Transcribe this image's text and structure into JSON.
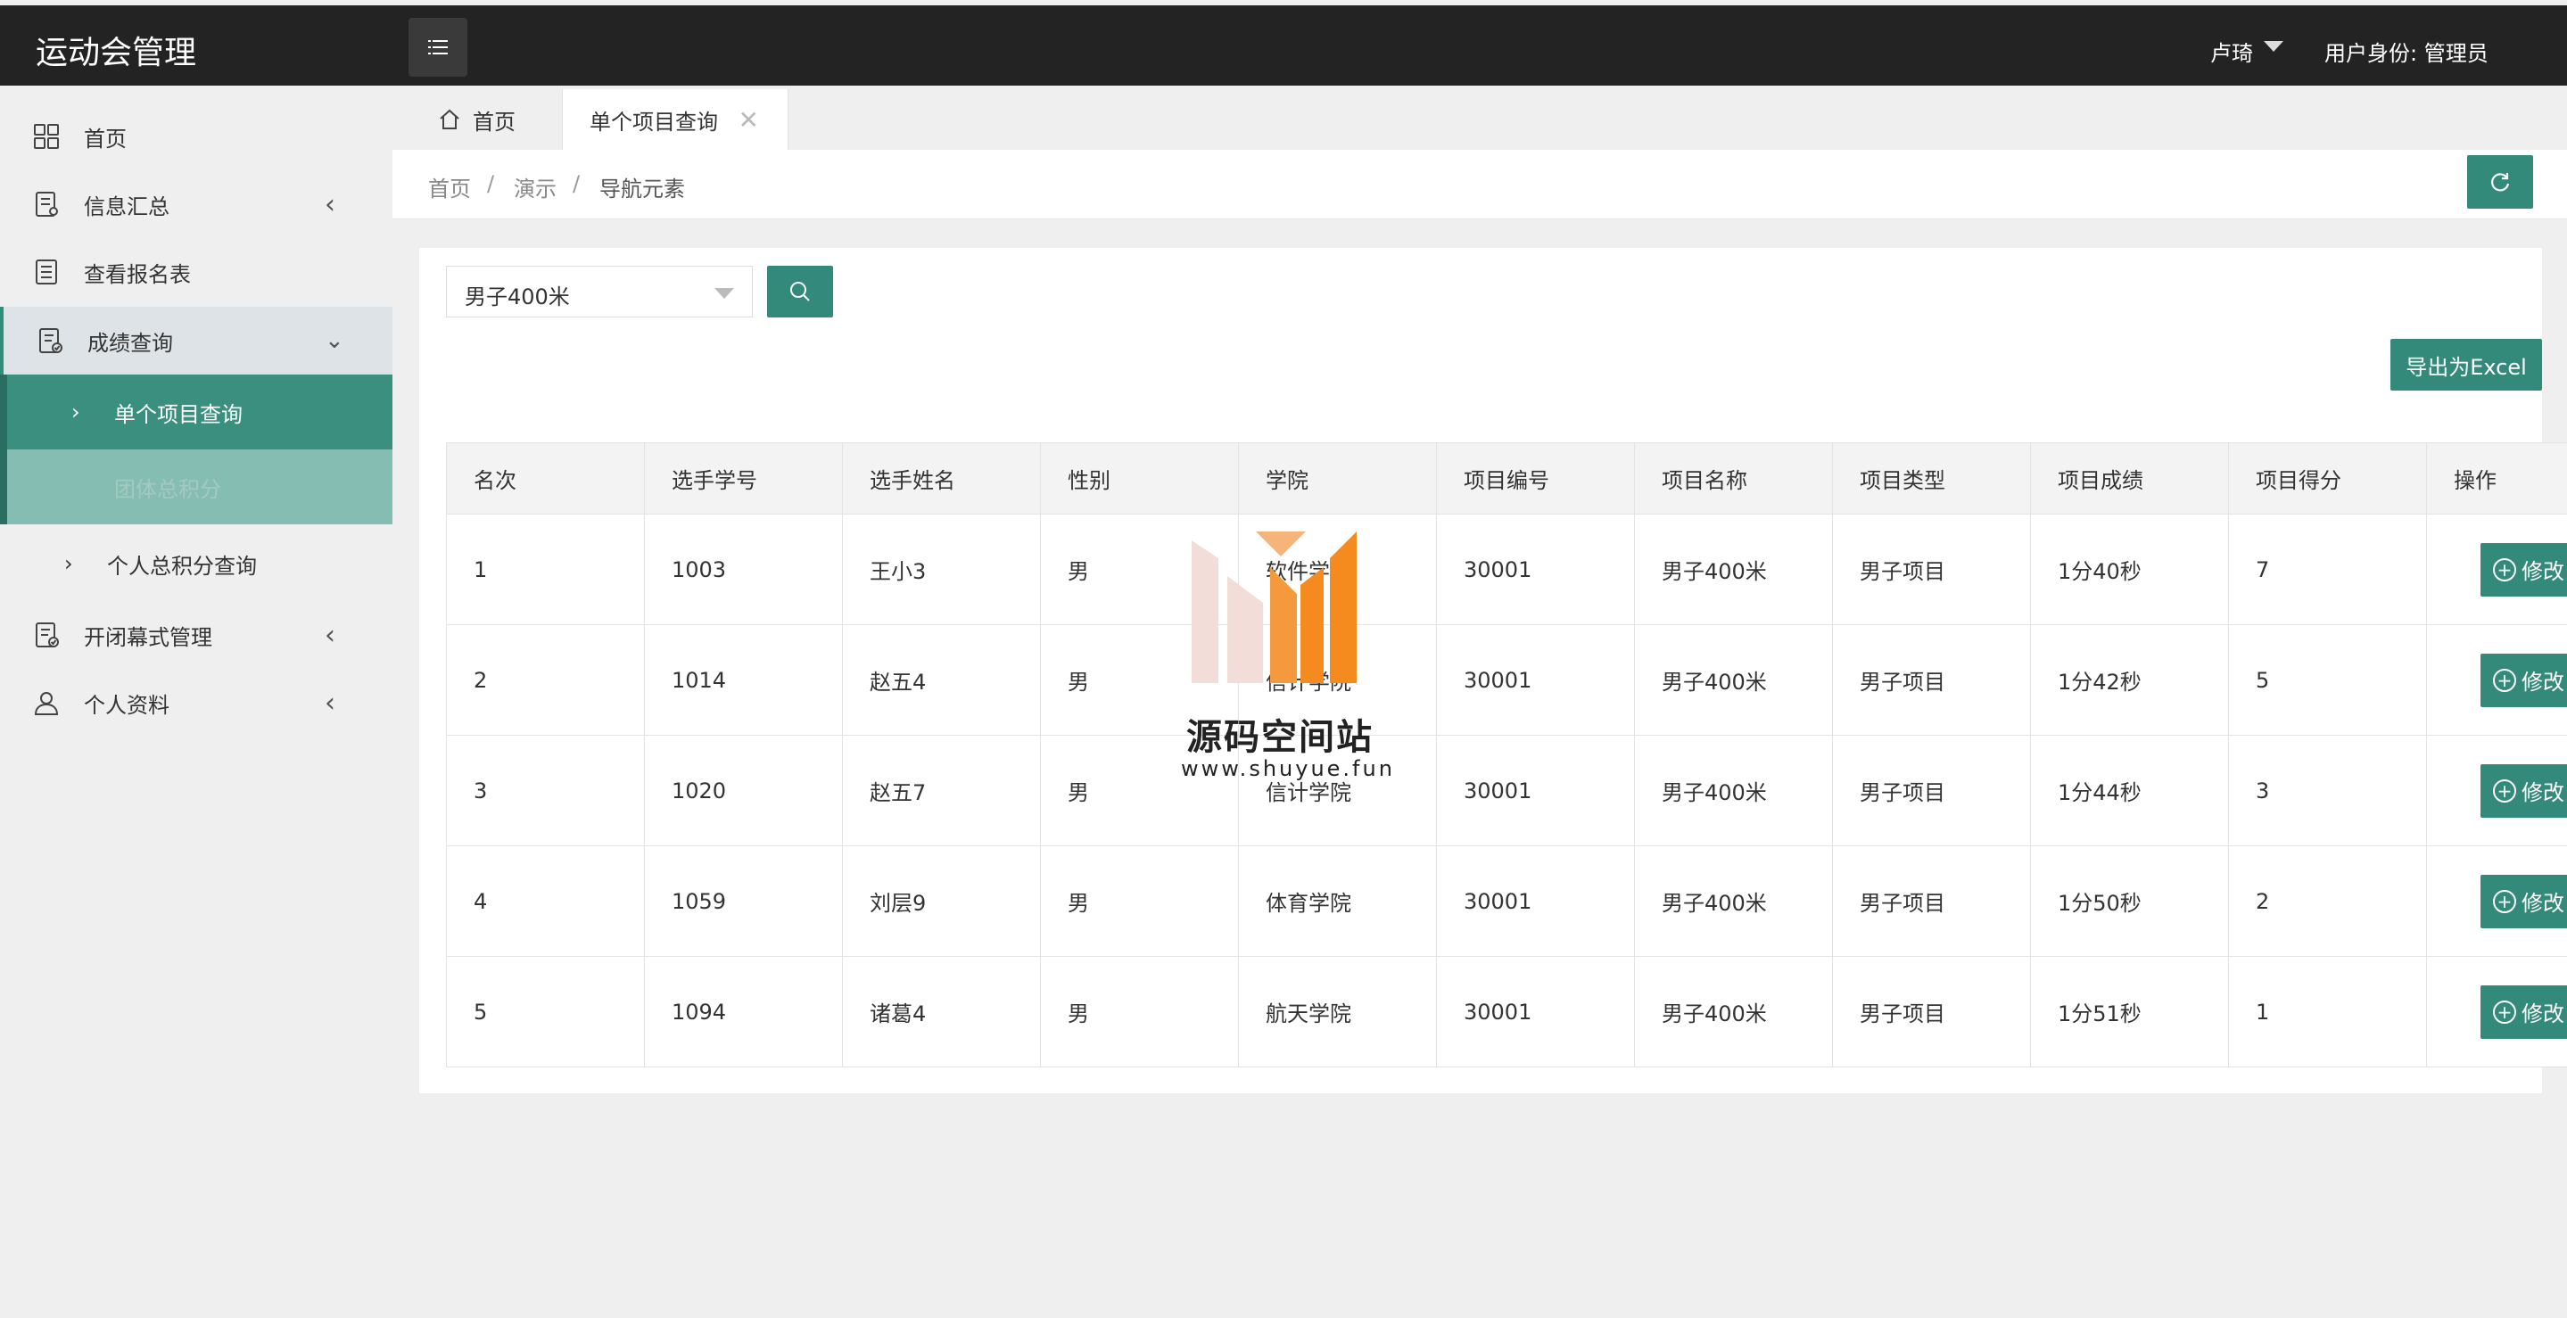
{
  "app": {
    "title": "运动会管理"
  },
  "header": {
    "user_name": "卢琦",
    "user_role": "用户身份: 管理员"
  },
  "sidebar": {
    "items": [
      {
        "label": "首页",
        "icon": "grid-icon"
      },
      {
        "label": "信息汇总",
        "icon": "document-icon"
      },
      {
        "label": "查看报名表",
        "icon": "list-icon"
      },
      {
        "label": "成绩查询",
        "icon": "document-check-icon"
      },
      {
        "label": "开闭幕式管理",
        "icon": "document-check-icon"
      },
      {
        "label": "个人资料",
        "icon": "user-icon"
      }
    ],
    "subitems": [
      {
        "label": "单个项目查询"
      },
      {
        "label": "团体总积分"
      },
      {
        "label": "个人总积分查询"
      }
    ]
  },
  "tabs": [
    {
      "label": "首页"
    },
    {
      "label": "单个项目查询"
    }
  ],
  "breadcrumb": [
    "首页",
    "演示",
    "导航元素"
  ],
  "filter": {
    "selected": "男子400米"
  },
  "toolbar": {
    "export_label": "导出为Excel"
  },
  "table": {
    "headers": [
      "名次",
      "选手学号",
      "选手姓名",
      "性别",
      "学院",
      "项目编号",
      "项目名称",
      "项目类型",
      "项目成绩",
      "项目得分",
      "操作"
    ],
    "rows": [
      [
        "1",
        "1003",
        "王小3",
        "男",
        "软件学院",
        "30001",
        "男子400米",
        "男子项目",
        "1分40秒",
        "7"
      ],
      [
        "2",
        "1014",
        "赵五4",
        "男",
        "信计学院",
        "30001",
        "男子400米",
        "男子项目",
        "1分42秒",
        "5"
      ],
      [
        "3",
        "1020",
        "赵五7",
        "男",
        "信计学院",
        "30001",
        "男子400米",
        "男子项目",
        "1分44秒",
        "3"
      ],
      [
        "4",
        "1059",
        "刘层9",
        "男",
        "体育学院",
        "30001",
        "男子400米",
        "男子项目",
        "1分50秒",
        "2"
      ],
      [
        "5",
        "1094",
        "诸葛4",
        "男",
        "航天学院",
        "30001",
        "男子400米",
        "男子项目",
        "1分51秒",
        "1"
      ]
    ],
    "edit_label": "修改"
  },
  "watermark": {
    "text": "源码空间站",
    "url": "www.shuyue.fun"
  },
  "colors": {
    "accent": "#33897a",
    "header": "#232323",
    "sidebar_active": "#3b8f7e"
  }
}
